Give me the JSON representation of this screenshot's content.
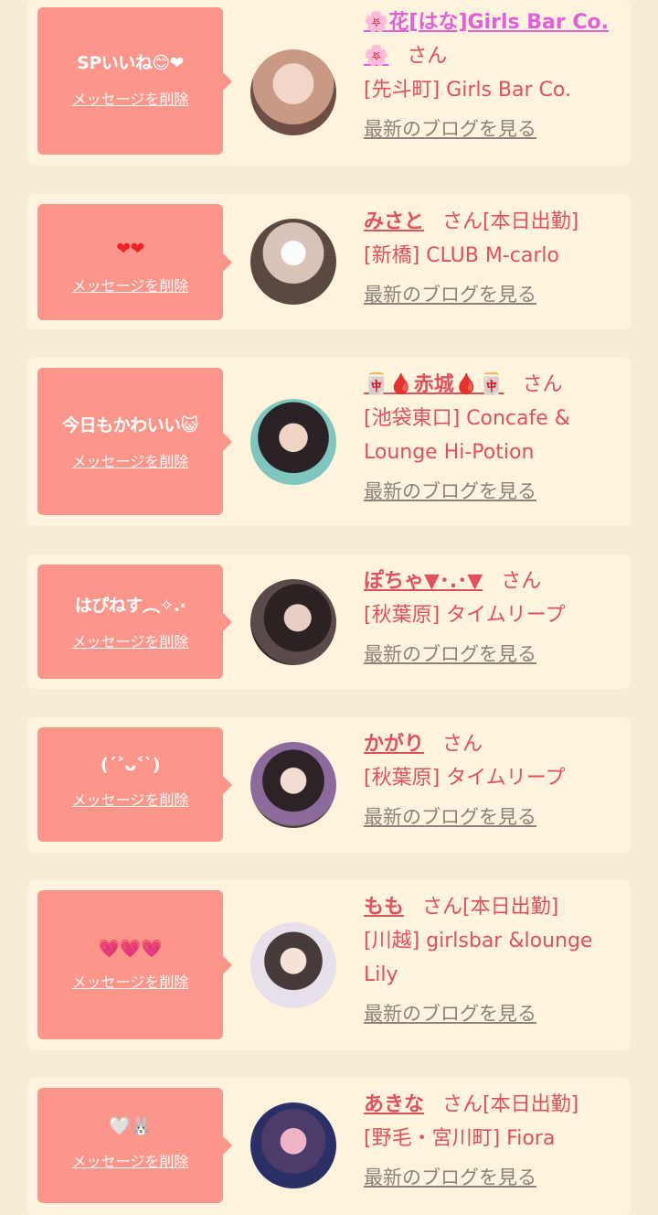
{
  "common": {
    "delete_label": "メッセージを削除",
    "blog_label": "最新のブログを見る",
    "san": "さん"
  },
  "items": [
    {
      "message": "SPいいね😊❤",
      "name": "🌸花[はな]Girls Bar Co.🌸",
      "suffix": "",
      "shop": "[先斗町] Girls Bar Co.",
      "avatar_icon": "girl-photo",
      "avatar_color": "#c89a86"
    },
    {
      "message": "❤❤",
      "name": "みさと",
      "suffix": "[本日出勤]",
      "shop": "[新橋] CLUB M-carlo",
      "avatar_icon": "girl-photo",
      "avatar_color": "#b79b8f"
    },
    {
      "message": "今日もかわいい😺",
      "name": "🀄🩸赤城🩸🀄",
      "suffix": "",
      "shop": "[池袋東口] Concafe & Lounge Hi-Potion",
      "avatar_icon": "girl-photo",
      "avatar_color": "#7fc6be"
    },
    {
      "message": "はぴねす︵✧.·",
      "name": "ぽちゃ▼･.･▼",
      "suffix": "",
      "shop": "[秋葉原] タイムリープ",
      "avatar_icon": "girl-photo",
      "avatar_color": "#4a3a3a"
    },
    {
      "message": "(ˊ˃ᴗ˂ˋ)",
      "name": "かがり",
      "suffix": "",
      "shop": "[秋葉原] タイムリープ",
      "avatar_icon": "girl-photo",
      "avatar_color": "#6f5a5a"
    },
    {
      "message": "💗💗💗",
      "name": "もも",
      "suffix": "[本日出勤]",
      "shop": "[川越] girlsbar &lounge Lily",
      "avatar_icon": "girl-photo",
      "avatar_color": "#d8cfd8"
    },
    {
      "message": "🤍🐰",
      "name": "あきな",
      "suffix": "[本日出勤]",
      "shop": "[野毛・宮川町] Fiora",
      "avatar_icon": "girl-photo",
      "avatar_color": "#3b4a8a"
    }
  ]
}
